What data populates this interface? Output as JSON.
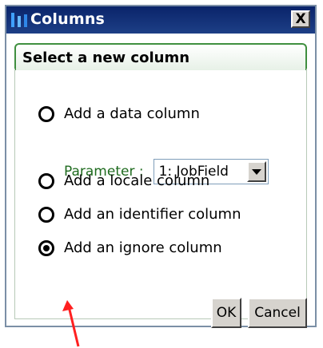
{
  "window": {
    "title": "Columns",
    "app_icon": "columns-app-icon",
    "close_label": "X"
  },
  "section": {
    "header": "Select a new column"
  },
  "radio_options": [
    {
      "label": "Add a data column",
      "checked": false
    },
    {
      "label": "Add a locale column",
      "checked": false
    },
    {
      "label": "Add an identifier column",
      "checked": false
    },
    {
      "label": "Add an ignore column",
      "checked": true
    }
  ],
  "parameter": {
    "label": "Parameter :",
    "selected": "1: JobField",
    "dropdown_icon": "chevron-down-icon"
  },
  "buttons": {
    "ok": "OK",
    "cancel": "Cancel"
  },
  "annotation": {
    "arrow_color": "#ff2020",
    "icon": "red-arrow-icon"
  }
}
